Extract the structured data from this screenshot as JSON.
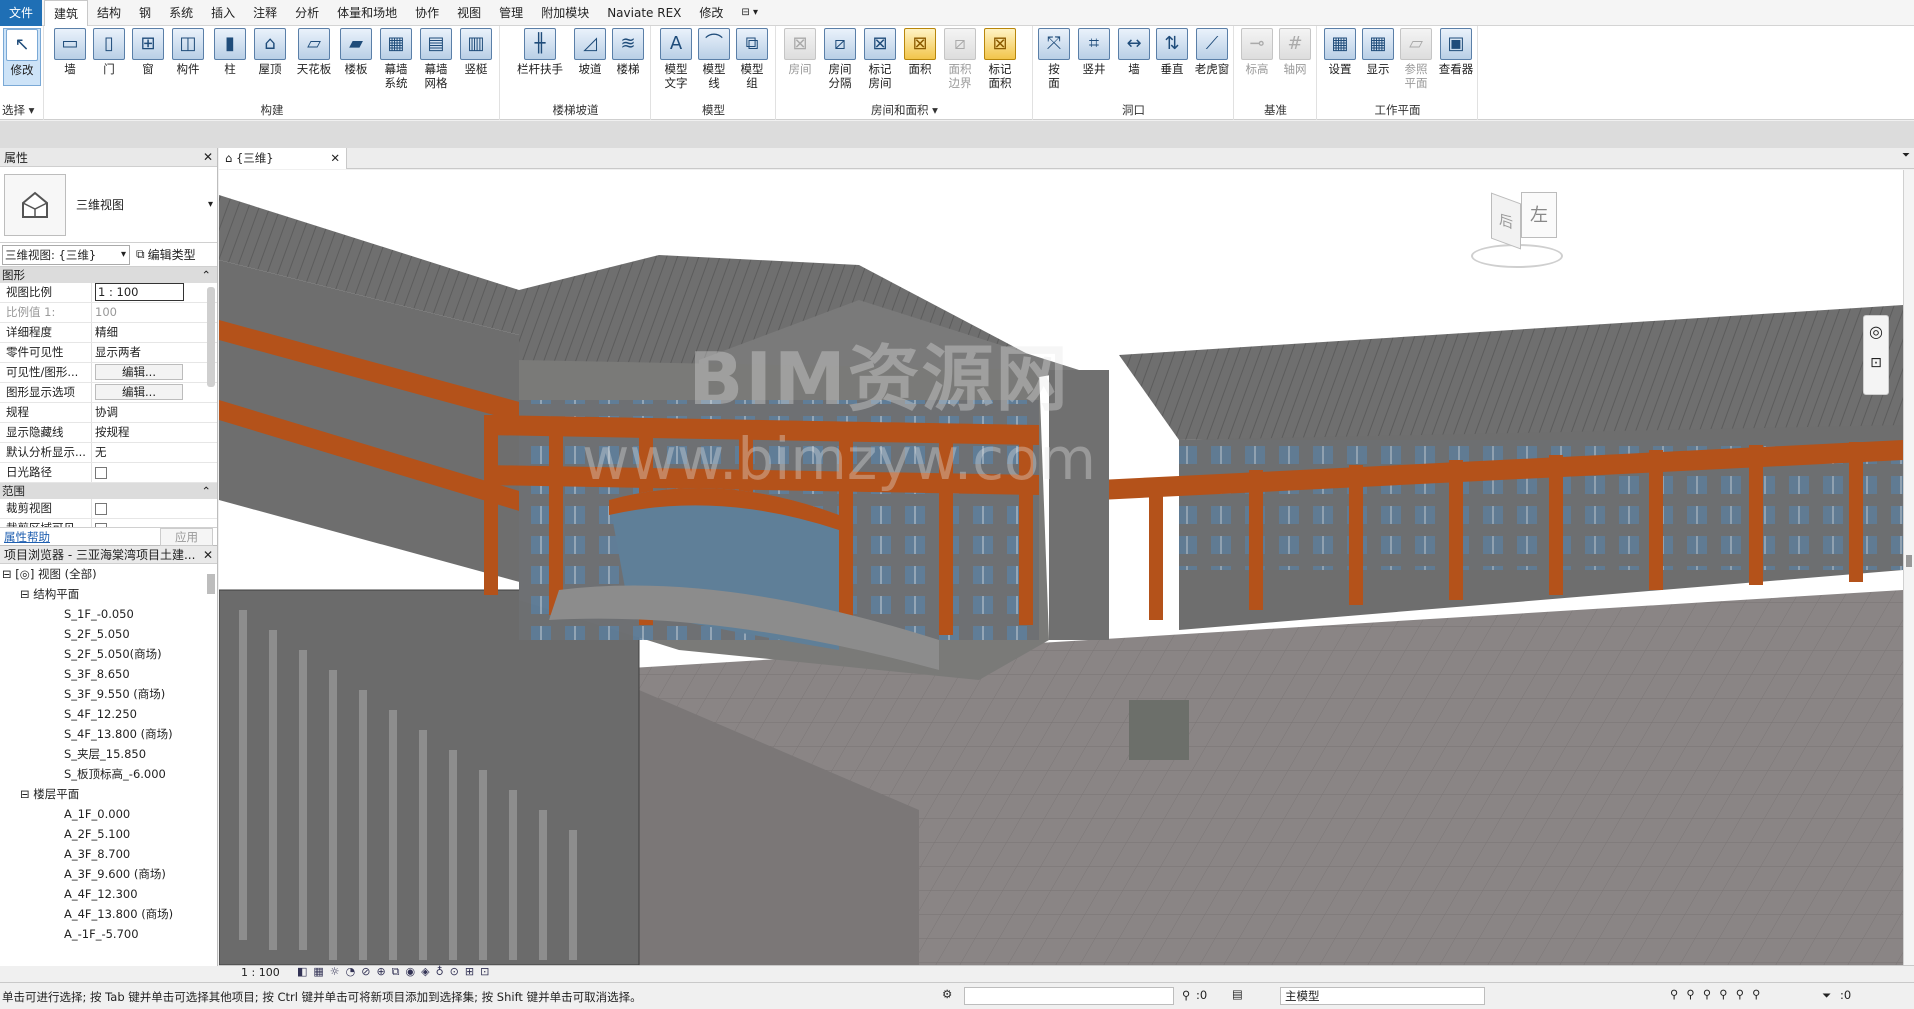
{
  "menu": {
    "file": "文件",
    "tabs": [
      "建筑",
      "结构",
      "钢",
      "系统",
      "插入",
      "注释",
      "分析",
      "体量和场地",
      "协作",
      "视图",
      "管理",
      "附加模块",
      "Naviate REX",
      "修改"
    ]
  },
  "ribbon": {
    "select": {
      "modify": "修改",
      "panel": "选择 ▾"
    },
    "build": {
      "tools": [
        "墙",
        "门",
        "窗",
        "构件",
        "柱",
        "屋顶",
        "天花板",
        "楼板",
        "幕墙\n系统",
        "幕墙\n网格",
        "竖梃"
      ],
      "panel": "构建"
    },
    "circulation": {
      "tools": [
        "栏杆扶手",
        "坡道",
        "楼梯"
      ],
      "panel": "楼梯坡道"
    },
    "model": {
      "tools": [
        "模型\n文字",
        "模型\n线",
        "模型\n组"
      ],
      "panel": "模型"
    },
    "room": {
      "tools": [
        "房间",
        "房间\n分隔",
        "标记\n房间",
        "面积",
        "面积\n边界",
        "标记\n面积"
      ],
      "panel": "房间和面积 ▾"
    },
    "opening": {
      "tools": [
        "按\n面",
        "竖井",
        "墙",
        "垂直",
        "老虎窗"
      ],
      "panel": "洞口"
    },
    "datum": {
      "tools": [
        "标高",
        "轴网"
      ],
      "panel": "基准"
    },
    "workplane": {
      "tools": [
        "设置",
        "显示",
        "参照\n平面",
        "查看器"
      ],
      "panel": "工作平面"
    }
  },
  "properties": {
    "title": "属性",
    "type_name": "三维视图",
    "selector": "三维视图: {三维}",
    "edit_type": "编辑类型",
    "group_graphics": "图形",
    "rows": [
      {
        "k": "视图比例",
        "v": "1 : 100"
      },
      {
        "k": "比例值 1:",
        "v": "100"
      },
      {
        "k": "详细程度",
        "v": "精细"
      },
      {
        "k": "零件可见性",
        "v": "显示两者"
      },
      {
        "k": "可见性/图形...",
        "v": "编辑..."
      },
      {
        "k": "图形显示选项",
        "v": "编辑..."
      },
      {
        "k": "规程",
        "v": "协调"
      },
      {
        "k": "显示隐藏线",
        "v": "按规程"
      },
      {
        "k": "默认分析显示...",
        "v": "无"
      },
      {
        "k": "日光路径",
        "v": ""
      }
    ],
    "group_extents": "范围",
    "rows2": [
      {
        "k": "裁剪视图",
        "v": ""
      },
      {
        "k": "裁剪区域可见",
        "v": ""
      }
    ],
    "help": "属性帮助",
    "apply": "应用"
  },
  "browser": {
    "title": "项目浏览器 - 三亚海棠湾项目土建...",
    "root": "视图 (全部)",
    "group1": "结构平面",
    "items1": [
      "S_1F_-0.050",
      "S_2F_5.050",
      "S_2F_5.050(商场)",
      "S_3F_8.650",
      "S_3F_9.550 (商场)",
      "S_4F_12.250",
      "S_4F_13.800 (商场)",
      "S_夹层_15.850",
      "S_板顶标高_-6.000"
    ],
    "group2": "楼层平面",
    "items2": [
      "A_1F_0.000",
      "A_2F_5.100",
      "A_3F_8.700",
      "A_3F_9.600 (商场)",
      "A_4F_12.300",
      "A_4F_13.800 (商场)",
      "A_-1F_-5.700"
    ]
  },
  "viewtab": {
    "label": "{三维}"
  },
  "viewbar": {
    "scale": "1 : 100"
  },
  "watermark": {
    "line1": "BIM资源网",
    "line2": "www.bimzyw.com"
  },
  "viewcube": {
    "face_left": "左",
    "face_front": "后"
  },
  "status": {
    "hint": "单击可进行选择; 按 Tab 键并单击可选择其他项目; 按 Ctrl 键并单击可将新项目添加到选择集; 按 Shift 键并单击可取消选择。",
    "count": ":0",
    "model": "主模型",
    "count2": ":0"
  }
}
